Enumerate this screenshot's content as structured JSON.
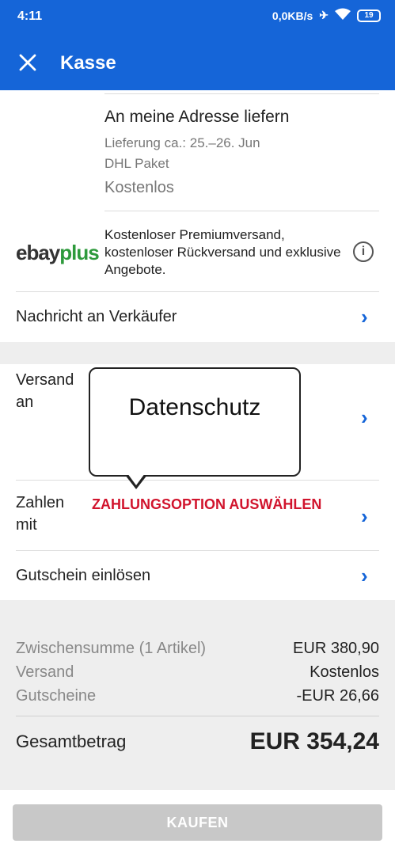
{
  "status": {
    "time": "4:11",
    "network": "0,0KB/s",
    "battery": "19"
  },
  "appbar": {
    "title": "Kasse"
  },
  "delivery": {
    "option": "An meine Adresse liefern",
    "estimate": "Lieferung ca.: 25.–26. Jun",
    "carrier": "DHL Paket",
    "price": "Kostenlos"
  },
  "ebay_plus": {
    "logo_part1": "ebay",
    "logo_part2": "plus",
    "text": "Kostenloser Premiumversand, kostenloser Rückversand und exklusive Angebote."
  },
  "seller_message": {
    "label": "Nachricht an Verkäufer"
  },
  "shipping_to": {
    "label_line1": "Versand",
    "label_line2": "an"
  },
  "tooltip": {
    "text": "Datenschutz"
  },
  "payment": {
    "label_line1": "Zahlen",
    "label_line2": "mit",
    "option": "ZAHLUNGSOPTION AUSWÄHLEN"
  },
  "voucher": {
    "label": "Gutschein einlösen"
  },
  "summary": {
    "subtotal_label": "Zwischensumme (1 Artikel)",
    "subtotal_value": "EUR 380,90",
    "shipping_label": "Versand",
    "shipping_value": "Kostenlos",
    "vouchers_label": "Gutscheine",
    "vouchers_value": "-EUR 26,66",
    "total_label": "Gesamtbetrag",
    "total_value": "EUR 354,24"
  },
  "buy_button": {
    "label": "KAUFEN"
  }
}
